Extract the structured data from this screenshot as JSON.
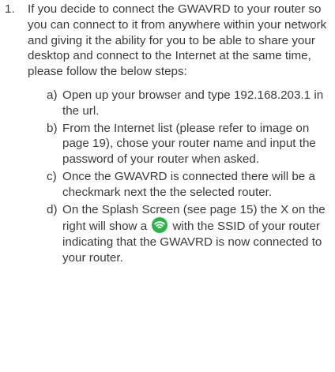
{
  "list": {
    "number": "1.",
    "intro": "If you decide to connect the GWAVRD to your router so you can connect to it from anywhere within your network and giving it the ability for you to be able to share your desktop and connect to the Internet at the same time, please follow the below steps:",
    "steps": [
      {
        "marker": "a)",
        "text": "Open up your browser and type 192.168.203.1 in the url."
      },
      {
        "marker": "b)",
        "text": "From the Internet list (please refer to image on page 19), chose your router name and input the password of your router when asked."
      },
      {
        "marker": "c)",
        "text": "Once the GWAVRD is connected there will be a checkmark next the the selected router."
      },
      {
        "marker": "d)",
        "text_before_icon": "On the Splash Screen (see page 15) the X on the right will show a",
        "text_after_icon": "with the SSID of your router indicating that the GWAVRD is now connected to your router."
      }
    ]
  },
  "icon": {
    "name": "wifi-icon",
    "color": "#2fb24c"
  }
}
